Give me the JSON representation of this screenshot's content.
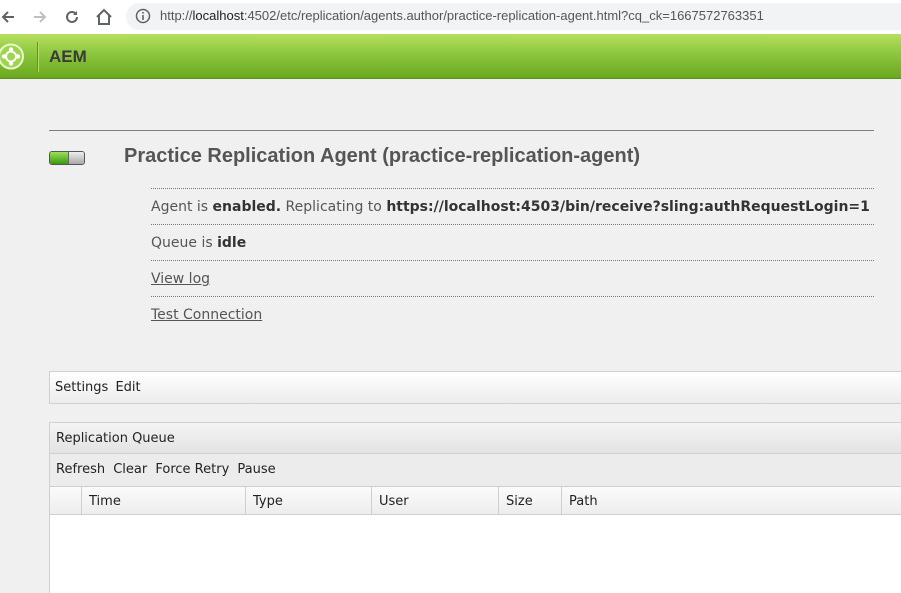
{
  "browser": {
    "url_host": "localhost",
    "url_prefix": "http://",
    "url_rest": ":4502/etc/replication/agents.author/practice-replication-agent.html?cq_ck=1667572763351"
  },
  "header": {
    "title": "AEM"
  },
  "agent": {
    "title": "Practice Replication Agent (practice-replication-agent)",
    "status_prefix": "Agent is ",
    "status_value": "enabled.",
    "replicating_label": " Replicating to ",
    "target_url": "https://localhost:4503/bin/receive?sling:authRequestLogin=1",
    "queue_prefix": "Queue is ",
    "queue_value": "idle",
    "view_log": "View log",
    "test_connection": "Test Connection"
  },
  "settings": {
    "label": "Settings",
    "edit": "Edit"
  },
  "queue": {
    "title": "Replication Queue",
    "tools": [
      "Refresh",
      "Clear",
      "Force Retry",
      "Pause"
    ],
    "columns": [
      "Time",
      "Type",
      "User",
      "Size",
      "Path"
    ]
  },
  "colors": {
    "header_green": "#8cc63e",
    "toggle_green": "#3a9a0e",
    "text": "#555555"
  }
}
